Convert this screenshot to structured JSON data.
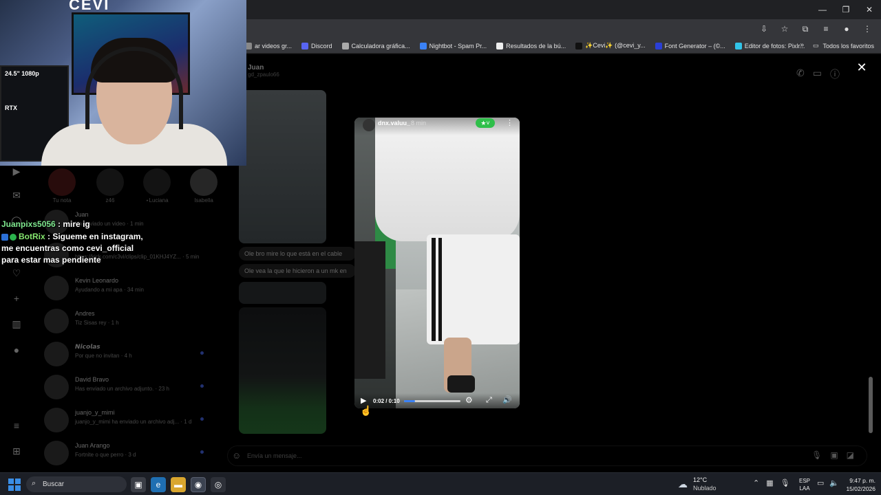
{
  "browser": {
    "bookmarks": [
      {
        "label": "ar videos gr...",
        "color": "#888888"
      },
      {
        "label": "Discord",
        "color": "#5865f2"
      },
      {
        "label": "Calculadora gráfica...",
        "color": "#aaaaaa"
      },
      {
        "label": "Nightbot - Spam Pr...",
        "color": "#3b82f6"
      },
      {
        "label": "Resultados de la bú...",
        "color": "#eeeeee"
      },
      {
        "label": "✨Cevi✨ (@cevi_y...",
        "color": "#111111"
      },
      {
        "label": "Font Generator – (©...",
        "color": "#2a3fd6"
      },
      {
        "label": "Editor de fotos: Pixlr...",
        "color": "#31c4e8"
      }
    ],
    "all_bookmarks": "Todos los favoritos"
  },
  "webcam": {
    "logo_text": "CEVI",
    "monitor_text": "24.5\" 1080p",
    "monitor_text2": "RTX"
  },
  "chat": {
    "msg1": {
      "user": "Juanpixs5056",
      "text": " : mire ig"
    },
    "msg2": {
      "user": "BotRix",
      "text": " : Sigueme en instagram, me encuentras como cevi_official para estar mas pendiente"
    }
  },
  "instagram": {
    "notes": [
      {
        "label": "Tu nota"
      },
      {
        "label": "z46"
      },
      {
        "label": "⋆Luciana"
      },
      {
        "label": "Isabella"
      }
    ],
    "conversations": [
      {
        "name": "Juan",
        "preview": "Ha enviado un video · 1 min"
      },
      {
        "name": "",
        "preview": "https://kick.com/c3vi/clips/clip_01KHJ4YZ... · 5 min"
      },
      {
        "name": "Kevin Leonardo",
        "preview": "Ayudando a mi apa · 34 min"
      },
      {
        "name": "Andres",
        "preview": "Tiz Sisas rey · 1 h"
      },
      {
        "name": "𝙉𝙞𝙘𝙤𝙡𝙖𝙨",
        "preview": "Por que no invitan · 4 h"
      },
      {
        "name": "David Bravo",
        "preview": "Has enviado un archivo adjunto. · 23 h"
      },
      {
        "name": "juanjo_y_mimi",
        "preview": "juanjo_y_mimi ha enviado un archivo adj... · 1 d"
      },
      {
        "name": "Juan Arango",
        "preview": "Fortnite o que perro · 3 d"
      }
    ],
    "thread": {
      "name": "Juan",
      "username": "gd_zpaulo66",
      "msg1": "Ole bro mire lo que está en el cable",
      "msg2": "Ole vea la que le hicieron a un mk en"
    },
    "composer_placeholder": "Envía un mensaje..."
  },
  "viewer": {
    "username": "dnx.valuu_",
    "time": "8 min",
    "timecode": "0:02 / 0:10",
    "progress": 0.2
  },
  "taskbar": {
    "search": "Buscar",
    "weather_temp": "12°C",
    "weather_desc": "Nublado",
    "lang1": "ESP",
    "lang2": "LAA",
    "time": "9:47 p. m.",
    "date": "15/02/2026"
  }
}
